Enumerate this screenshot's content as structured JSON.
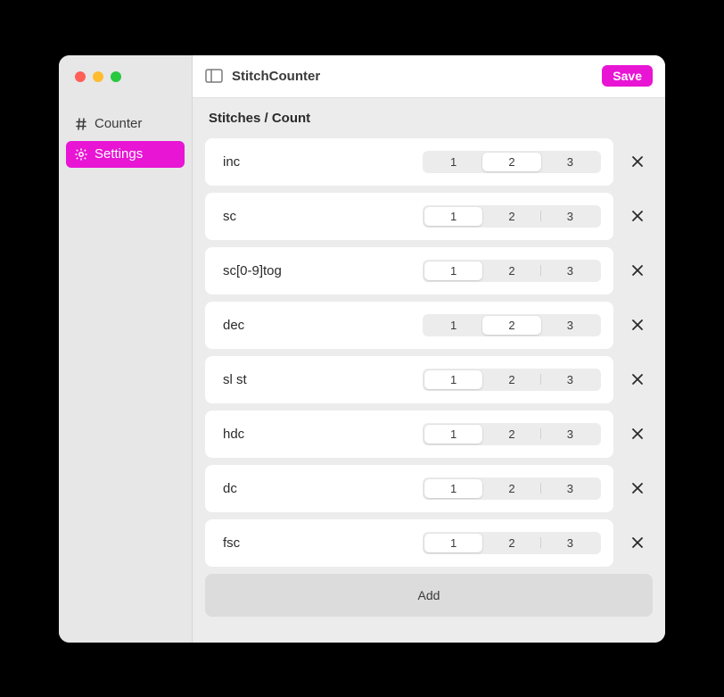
{
  "window": {
    "title": "StitchCounter"
  },
  "toolbar": {
    "save_label": "Save"
  },
  "sidebar": {
    "items": [
      {
        "label": "Counter",
        "active": false,
        "icon": "hash"
      },
      {
        "label": "Settings",
        "active": true,
        "icon": "gear"
      }
    ]
  },
  "section": {
    "title": "Stitches / Count"
  },
  "segment_options": [
    "1",
    "2",
    "3"
  ],
  "stitches": [
    {
      "name": "inc",
      "count": 2
    },
    {
      "name": "sc",
      "count": 1
    },
    {
      "name": "sc[0-9]tog",
      "count": 1
    },
    {
      "name": "dec",
      "count": 2
    },
    {
      "name": "sl st",
      "count": 1
    },
    {
      "name": "hdc",
      "count": 1
    },
    {
      "name": "dc",
      "count": 1
    },
    {
      "name": "fsc",
      "count": 1
    }
  ],
  "add_button": {
    "label": "Add"
  }
}
